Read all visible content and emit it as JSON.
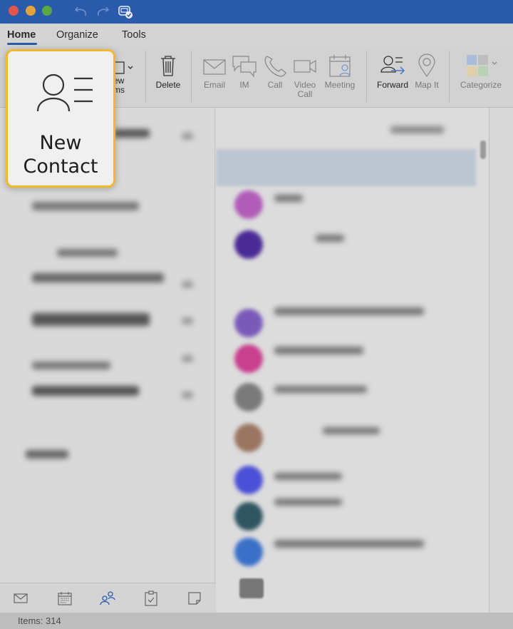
{
  "window": {
    "titlebar_icons": [
      "undo-icon",
      "redo-icon",
      "sync-status-icon"
    ]
  },
  "tabs": [
    {
      "label": "Home",
      "active": true
    },
    {
      "label": "Organize",
      "active": false
    },
    {
      "label": "Tools",
      "active": false
    }
  ],
  "ribbon": {
    "new_items_partial": "ew\nms",
    "delete": "Delete",
    "email": "Email",
    "im": "IM",
    "call": "Call",
    "video_call_1": "Video",
    "video_call_2": "Call",
    "meeting": "Meeting",
    "forward": "Forward",
    "map_it": "Map It",
    "categorize": "Categorize"
  },
  "callout": {
    "line1": "New",
    "line2": "Contact"
  },
  "contact_list": {
    "avatar_colors": [
      "#b05cb8",
      "#4a2a95",
      "#7a5ab8",
      "#c8408e",
      "#7a7a7a",
      "#9a7560",
      "#4a50d8",
      "#2e5560",
      "#3a70c8"
    ]
  },
  "bottom_nav": [
    "mail-icon",
    "calendar-icon",
    "people-icon",
    "tasks-icon",
    "notes-icon"
  ],
  "status": {
    "items": "Items: 314"
  },
  "colors": {
    "accent": "#2a5aaa",
    "highlight": "#f0b929"
  }
}
